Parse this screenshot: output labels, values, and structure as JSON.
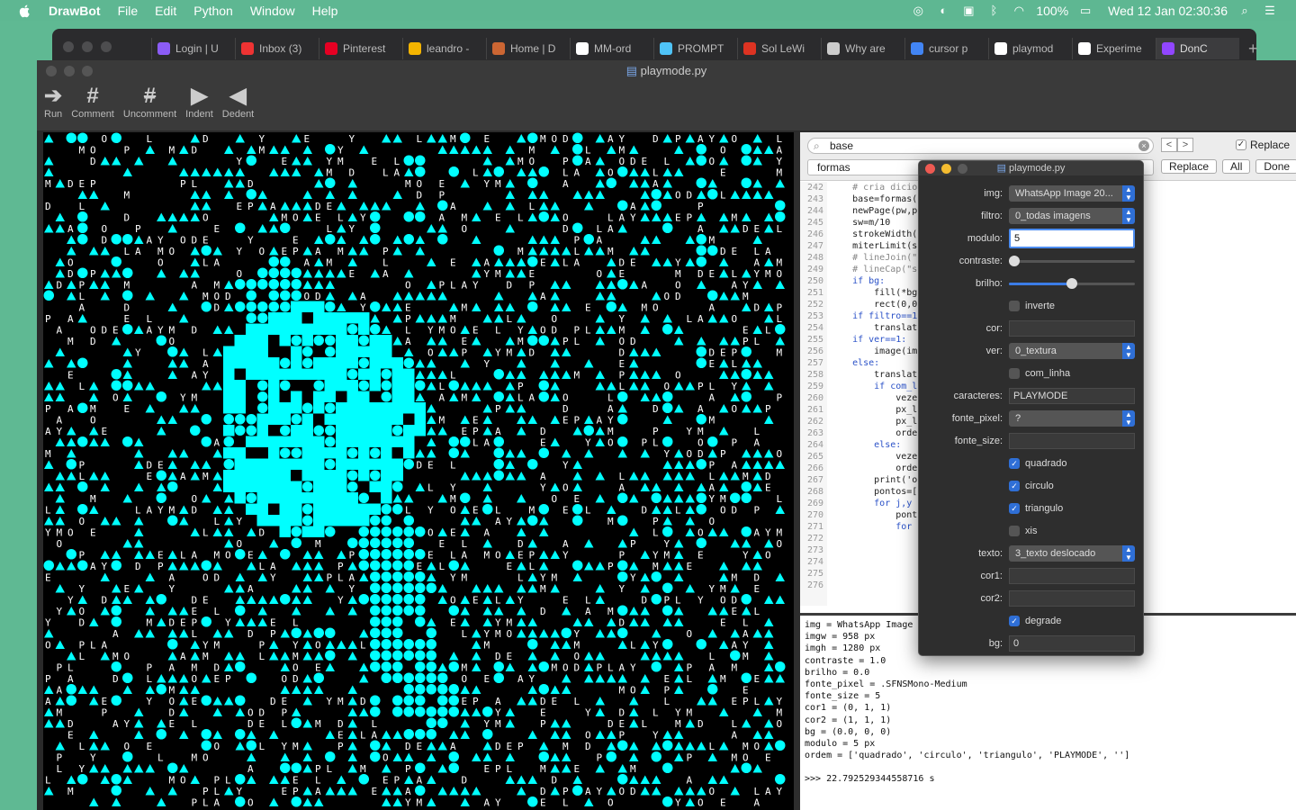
{
  "menubar": {
    "app": "DrawBot",
    "items": [
      "File",
      "Edit",
      "Python",
      "Window",
      "Help"
    ],
    "battery": "100%",
    "datetime": "Wed 12 Jan  02:30:36"
  },
  "browser": {
    "tabs": [
      {
        "label": "Login | U",
        "color": "#8b5cf6"
      },
      {
        "label": "Inbox (3)",
        "color": "#e33"
      },
      {
        "label": "Pinterest",
        "color": "#e60023"
      },
      {
        "label": "leandro -",
        "color": "#f4b400"
      },
      {
        "label": "Home | D",
        "color": "#c63"
      },
      {
        "label": "MM-ord",
        "color": "#fff"
      },
      {
        "label": "PROMPT",
        "color": "#4fc3f7"
      },
      {
        "label": "Sol LeWi",
        "color": "#d32"
      },
      {
        "label": "Why are",
        "color": "#ccc"
      },
      {
        "label": "cursor p",
        "color": "#4285f4"
      },
      {
        "label": "playmod",
        "color": "#fff"
      },
      {
        "label": "Experime",
        "color": "#fff"
      },
      {
        "label": "DonC",
        "color": "#9146ff"
      }
    ],
    "plus": "+"
  },
  "window": {
    "title": "playmode.py",
    "toolbar": [
      {
        "label": "Run",
        "glyph": "➔"
      },
      {
        "label": "Comment",
        "glyph": "#"
      },
      {
        "label": "Uncomment",
        "glyph": "#"
      },
      {
        "label": "Indent",
        "glyph": "▶"
      },
      {
        "label": "Dedent",
        "glyph": "◀"
      }
    ]
  },
  "find": {
    "search": "base",
    "replace": "formas",
    "prev": "<",
    "next": ">",
    "replace_check": "Replace",
    "btn_replace": "Replace",
    "btn_all": "All",
    "btn_done": "Done"
  },
  "code": {
    "line_numbers": [
      "242",
      "243",
      "244",
      "245",
      "246",
      "247",
      "248",
      "249",
      "250",
      "251",
      "252",
      "253",
      "254",
      "255",
      "256",
      "257",
      "258",
      "259",
      "260",
      "261",
      "262",
      "263",
      "264",
      "265",
      "266",
      "267",
      "268",
      "269",
      "270",
      "271",
      "272",
      "273",
      "274",
      "275",
      "276"
    ],
    "lines": [
      "    # cria dicio",
      "    base=formas(",
      "",
      "    newPage(pw,p",
      "    sw=m/10",
      "    strokeWidth(",
      "    miterLimit(s",
      "    # lineJoin(\"",
      "    # lineCap(\"s",
      "",
      "    if bg:",
      "        fill(*bg",
      "        rect(0,0",
      "    if filtro==1",
      "        translat",
      "    if ver==1:",
      "        image(im",
      "",
      "    else:",
      "        translat",
      "",
      "        if com_l",
      "            veze",
      "            px_l",
      "            px_l",
      "            orde",
      "        else:",
      "            veze",
      "            orde",
      "        print('o",
      "",
      "        pontos=[",
      "        for j,y",
      "            pont",
      "            for"
    ]
  },
  "console": [
    "img = WhatsApp Image",
    "imgw = 958 px",
    "imgh = 1280 px",
    "contraste = 1.0",
    "brilho = 0.0",
    "fonte_pixel = .SFNSMono-Medium",
    "fonte_size = 5",
    "cor1 = (0, 1, 1)",
    "cor2 = (1, 1, 1)",
    "bg = (0.0, 0, 0)",
    "modulo = 5 px",
    "ordem = ['quadrado', 'circulo', 'triangulo', 'PLAYMODE', '']",
    "",
    ">>> 22.792529344558716 s"
  ],
  "panel": {
    "title": "playmode.py",
    "img_label": "img:",
    "img_value": "WhatsApp Image 20...",
    "filtro_label": "filtro:",
    "filtro_value": "0_todas imagens",
    "modulo_label": "modulo:",
    "modulo_value": "5",
    "contraste_label": "contraste:",
    "contraste_level": 0.0,
    "brilho_label": "brilho:",
    "brilho_level": 0.5,
    "inverte_label": "inverte",
    "inverte_checked": false,
    "cor_label": "cor:",
    "cor_value": "",
    "ver_label": "ver:",
    "ver_value": "0_textura",
    "com_linha_label": "com_linha",
    "com_linha_checked": false,
    "caracteres_label": "caracteres:",
    "caracteres_value": "PLAYMODE",
    "fonte_pixel_label": "fonte_pixel:",
    "fonte_pixel_value": "?",
    "fonte_size_label": "fonte_size:",
    "fonte_size_value": "",
    "quadrado_label": "quadrado",
    "quadrado_checked": true,
    "circulo_label": "circulo",
    "circulo_checked": true,
    "triangulo_label": "triangulo",
    "triangulo_checked": true,
    "xis_label": "xis",
    "xis_checked": false,
    "texto_label": "texto:",
    "texto_value": "3_texto deslocado",
    "cor1_label": "cor1:",
    "cor1_value": "",
    "cor2_label": "cor2:",
    "cor2_value": "",
    "degrade_label": "degrade",
    "degrade_checked": true,
    "bg_label": "bg:",
    "bg_value": "0"
  },
  "canvas": {
    "characters": "PLAYMODE",
    "color_shape": "#00ffff",
    "color_text": "#ffffff",
    "background": "#000000"
  },
  "colors": {
    "accent": "#2f6fd6",
    "desktop": "#5fb993"
  }
}
